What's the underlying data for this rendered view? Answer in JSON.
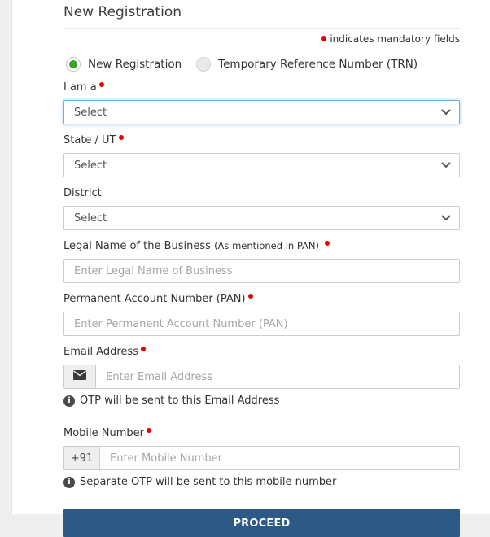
{
  "header": {
    "title": "New Registration",
    "mandatory_note": "indicates mandatory fields"
  },
  "registration_type": {
    "options": [
      {
        "label": "New Registration",
        "selected": true
      },
      {
        "label": "Temporary Reference Number (TRN)",
        "selected": false
      }
    ]
  },
  "form": {
    "i_am_a": {
      "label": "I am a",
      "required": true,
      "value": "Select"
    },
    "state": {
      "label": "State / UT",
      "required": true,
      "value": "Select"
    },
    "district": {
      "label": "District",
      "required": false,
      "value": "Select"
    },
    "legal_name": {
      "label": "Legal Name of the Business",
      "sublabel": "(As mentioned in PAN)",
      "required": true,
      "placeholder": "Enter Legal Name of Business"
    },
    "pan": {
      "label": "Permanent Account Number (PAN)",
      "required": true,
      "placeholder": "Enter Permanent Account Number (PAN)"
    },
    "email": {
      "label": "Email Address",
      "required": true,
      "placeholder": "Enter Email Address",
      "hint": "OTP will be sent to this Email Address"
    },
    "mobile": {
      "label": "Mobile Number",
      "required": true,
      "prefix": "+91",
      "placeholder": "Enter Mobile Number",
      "hint": "Separate OTP will be sent to this mobile number"
    }
  },
  "actions": {
    "proceed": "PROCEED"
  },
  "icons": {
    "email_addon": "envelope-icon",
    "hint": "info-icon",
    "select_caret": "chevron-down-icon"
  },
  "colors": {
    "button_blue": "#2d5986",
    "focus_blue": "#66afe9",
    "radio_green": "#3fa32a",
    "required_red": "#e60000",
    "page_strip_gray": "#efefef"
  }
}
